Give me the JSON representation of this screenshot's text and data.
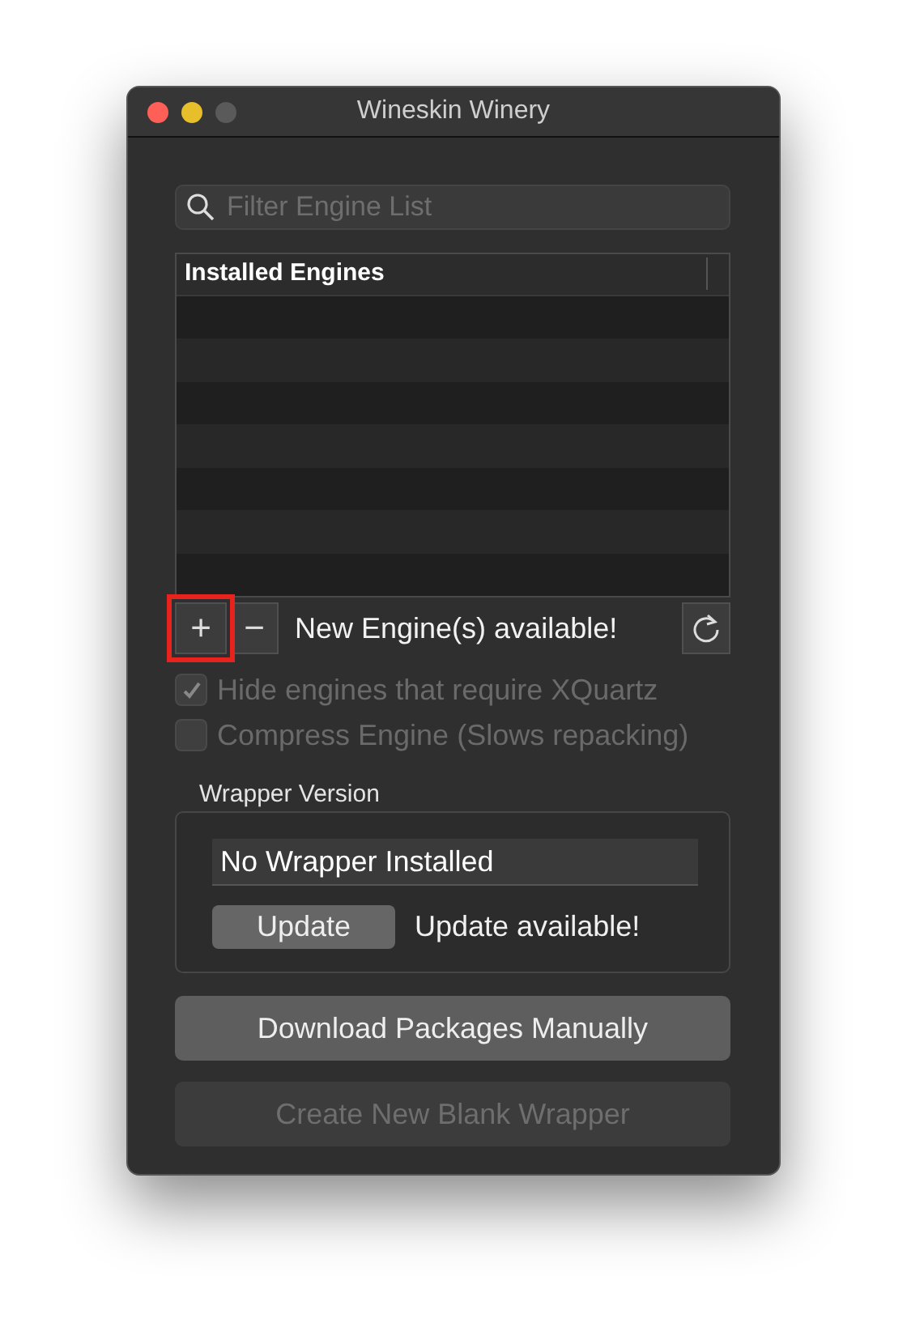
{
  "window": {
    "title": "Wineskin Winery"
  },
  "search": {
    "placeholder": "Filter Engine List"
  },
  "table": {
    "columns": [
      "Installed Engines"
    ]
  },
  "engine_toolbar": {
    "add_button": {
      "label": "+",
      "highlighted": true
    },
    "remove_button": {
      "label": "−"
    },
    "status": "New Engine(s) available!"
  },
  "options": [
    {
      "label": "Hide engines that require XQuartz",
      "checked": true,
      "disabled": true
    },
    {
      "label": "Compress Engine (Slows repacking)",
      "checked": false,
      "disabled": true
    }
  ],
  "wrapper": {
    "title": "Wrapper Version",
    "value": "No Wrapper Installed",
    "update_button": "Update",
    "status": "Update available!"
  },
  "buttons": [
    {
      "label": "Download Packages Manually",
      "disabled": false
    },
    {
      "label": "Create New Blank Wrapper",
      "disabled": true
    }
  ]
}
